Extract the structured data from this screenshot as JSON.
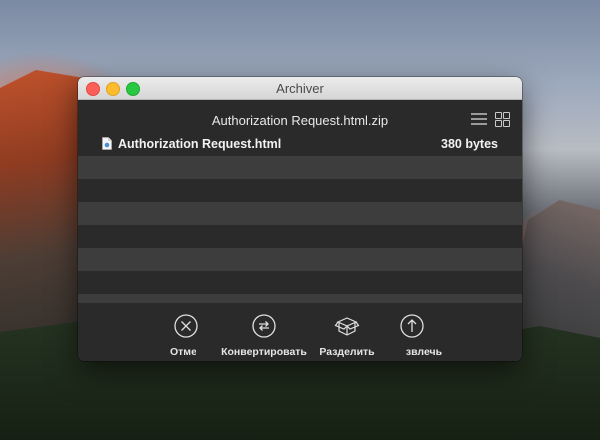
{
  "window": {
    "title": "Archiver"
  },
  "archive": {
    "name": "Authorization Request.html.zip"
  },
  "view_toggle": {
    "list_icon": "list-view-icon",
    "grid_icon": "grid-view-icon"
  },
  "files": [
    {
      "name": "Authorization Request.html",
      "size": "380 bytes",
      "icon": "html-file-icon"
    }
  ],
  "toolbar": {
    "items": [
      {
        "label": "Отмен",
        "icon": "cancel-icon"
      },
      {
        "label": "Конвертировать",
        "icon": "convert-icon"
      },
      {
        "label": "Разделить",
        "icon": "split-box-icon"
      },
      {
        "label": "звлечь",
        "icon": "extract-icon"
      }
    ]
  },
  "colors": {
    "window_bg": "#2b2a2b",
    "row_alt": "#3e3d3e",
    "close": "#fc5f57",
    "minimize": "#fdbc2e",
    "maximize": "#28c840"
  }
}
